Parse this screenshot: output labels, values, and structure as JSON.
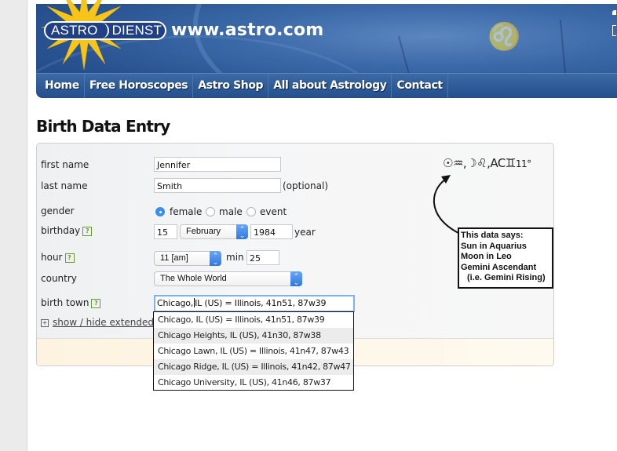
{
  "header": {
    "logo_left": "ASTRO",
    "logo_right": "DIENST",
    "site_url": "www.astro.com",
    "brand_color": "#2a5592",
    "star_color": "#f7c51a"
  },
  "nav": {
    "items": [
      {
        "label": "Home"
      },
      {
        "label": "Free Horoscopes"
      },
      {
        "label": "Astro Shop"
      },
      {
        "label": "All about Astrology"
      },
      {
        "label": "Contact"
      }
    ]
  },
  "page": {
    "title": "Birth Data Entry"
  },
  "form": {
    "first_name": {
      "label": "first name",
      "value": "Jennifer"
    },
    "last_name": {
      "label": "last name",
      "value": "Smith",
      "note": "(optional)"
    },
    "gender": {
      "label": "gender",
      "options": [
        {
          "label": "female",
          "selected": true
        },
        {
          "label": "male",
          "selected": false
        },
        {
          "label": "event",
          "selected": false
        }
      ]
    },
    "birthday": {
      "label": "birthday",
      "help": "?",
      "day": "15",
      "month": "February",
      "year": "1984",
      "year_label": "year"
    },
    "hour": {
      "label": "hour",
      "help": "?",
      "value": "11 [am]",
      "min_label": "min",
      "min_value": "25"
    },
    "country": {
      "label": "country",
      "value": "The Whole World"
    },
    "birth_town": {
      "label": "birth town",
      "help": "?",
      "value_before_caret": "Chicago,",
      "value_after_caret": "IL (US) = Illinois, 41n51, 87w39",
      "suggestions": [
        "Chicago, IL (US) = Illinois, 41n51, 87w39",
        "Chicago Heights, IL (US), 41n30, 87w38",
        "Chicago Lawn, IL (US) = Illinois, 41n47, 87w43",
        "Chicago Ridge, IL (US) = Illinois, 41n42, 87w47",
        "Chicago University, IL (US), 41n46, 87w37"
      ]
    },
    "extended_toggle": {
      "icon": "plus-box-icon",
      "label": "show / hide extended s"
    }
  },
  "astro_summary": {
    "sun_symbol": "☉",
    "sun_sign": "♒",
    "moon_symbol": "☽",
    "moon_sign": "♌",
    "asc_label": "AC",
    "asc_sign": "♊",
    "asc_degree": "11°"
  },
  "annotation": {
    "lines": [
      "This data says:",
      "Sun in Aquarius",
      "Moon in Leo",
      "Gemini Ascendant",
      "(i.e. Gemini Rising)"
    ]
  }
}
